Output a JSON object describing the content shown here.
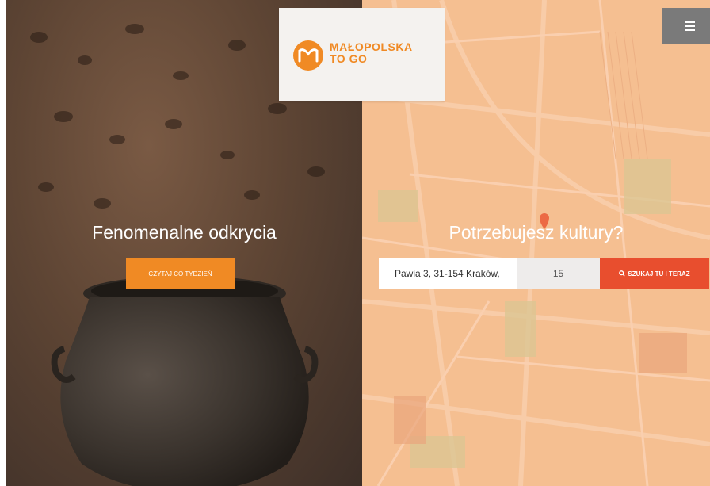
{
  "brand": {
    "line1": "MAŁOPOLSKA",
    "line2": "TO GO",
    "color": "#f08a24"
  },
  "menu": {
    "icon": "hamburger-icon"
  },
  "left_section": {
    "headline": "Fenomenalne odkrycia",
    "button_label": "CZYTAJ CO TYDZIEŃ"
  },
  "right_section": {
    "headline": "Potrzebujesz kultury?",
    "address_value": "Pawia 3, 31-154 Kraków,",
    "number_value": "15",
    "search_label": "SZUKAJ TU I TERAZ",
    "search_icon": "search-icon"
  },
  "colors": {
    "accent_orange": "#f08a24",
    "search_red": "#e84e2e",
    "menu_gray": "#7a7a7a"
  }
}
